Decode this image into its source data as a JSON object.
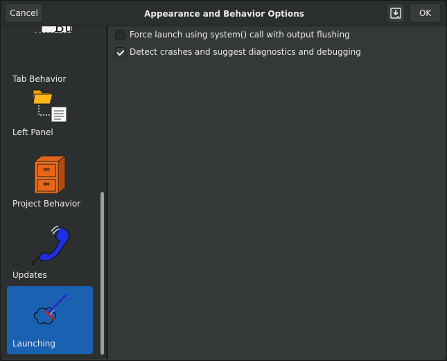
{
  "header": {
    "title": "Appearance and Behavior Options",
    "cancel_label": "Cancel",
    "ok_label": "OK",
    "save_icon": "save-icon"
  },
  "sidebar": {
    "items": [
      {
        "label": "Tab Behavior",
        "icon": "tab-behavior-icon",
        "selected": false
      },
      {
        "label": "Left Panel",
        "icon": "folder-tree-icon",
        "selected": false
      },
      {
        "label": "Project Behavior",
        "icon": "filing-cabinet-icon",
        "selected": false
      },
      {
        "label": "Updates",
        "icon": "telephone-icon",
        "selected": false
      },
      {
        "label": "Launching",
        "icon": "rocket-launch-icon",
        "selected": true
      }
    ],
    "partial_icon_text": "Bu"
  },
  "options": [
    {
      "label": "Force launch using system() call with output flushing",
      "checked": false
    },
    {
      "label": "Detect crashes and suggest diagnostics and debugging",
      "checked": true
    }
  ],
  "colors": {
    "accent": "#1b61b1",
    "window_bg": "#353839",
    "sidebar_bg": "#2c2f30"
  }
}
